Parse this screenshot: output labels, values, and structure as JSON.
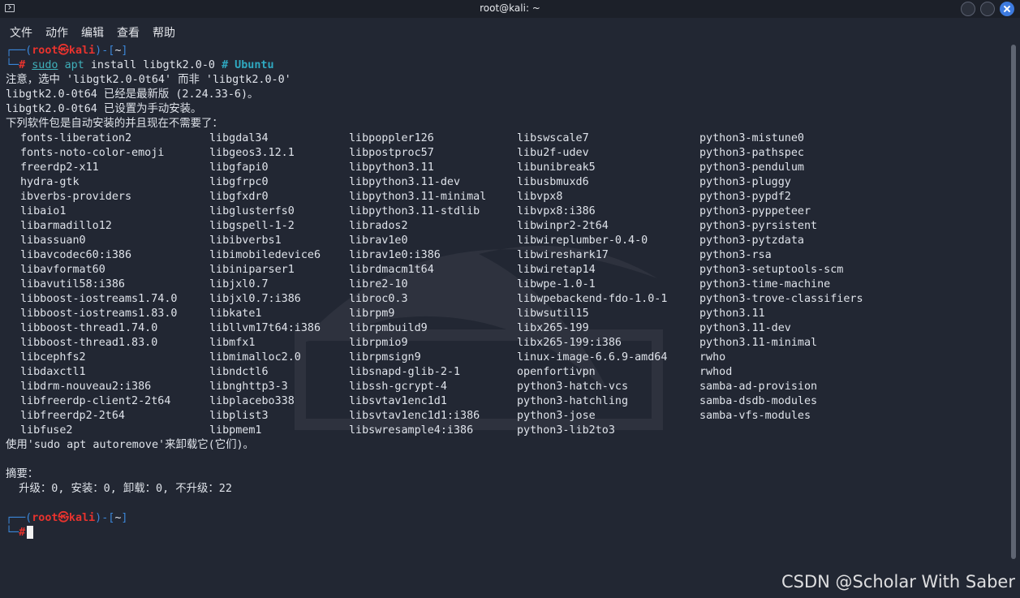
{
  "window": {
    "title": "root@kali: ~"
  },
  "menu": [
    "文件",
    "动作",
    "编辑",
    "查看",
    "帮助"
  ],
  "prompt": {
    "user": "root",
    "at_symbol": "㉿",
    "host": "kali",
    "cwd": "~",
    "hash": "#"
  },
  "command": {
    "sudo": "sudo",
    "apt": "apt",
    "args": "install libgtk2.0-0",
    "comment": "# Ubuntu"
  },
  "output_lines": [
    "注意，选中 'libgtk2.0-0t64' 而非 'libgtk2.0-0'",
    "libgtk2.0-0t64 已经是最新版 (2.24.33-6)。",
    "libgtk2.0-0t64 已设置为手动安装。",
    "下列软件包是自动安装的并且现在不需要了："
  ],
  "package_columns": [
    [
      "fonts-liberation2",
      "fonts-noto-color-emoji",
      "freerdp2-x11",
      "hydra-gtk",
      "ibverbs-providers",
      "libaio1",
      "libarmadillo12",
      "libassuan0",
      "libavcodec60:i386",
      "libavformat60",
      "libavutil58:i386",
      "libboost-iostreams1.74.0",
      "libboost-iostreams1.83.0",
      "libboost-thread1.74.0",
      "libboost-thread1.83.0",
      "libcephfs2",
      "libdaxctl1",
      "libdrm-nouveau2:i386",
      "libfreerdp-client2-2t64",
      "libfreerdp2-2t64",
      "libfuse2"
    ],
    [
      "libgdal34",
      "libgeos3.12.1",
      "libgfapi0",
      "libgfrpc0",
      "libgfxdr0",
      "libglusterfs0",
      "libgspell-1-2",
      "libibverbs1",
      "libimobiledevice6",
      "libiniparser1",
      "libjxl0.7",
      "libjxl0.7:i386",
      "libkate1",
      "libllvm17t64:i386",
      "libmfx1",
      "libmimalloc2.0",
      "libndctl6",
      "libnghttp3-3",
      "libplacebo338",
      "libplist3",
      "libpmem1"
    ],
    [
      "libpoppler126",
      "libpostproc57",
      "libpython3.11",
      "libpython3.11-dev",
      "libpython3.11-minimal",
      "libpython3.11-stdlib",
      "librados2",
      "librav1e0",
      "librav1e0:i386",
      "librdmacm1t64",
      "libre2-10",
      "libroc0.3",
      "librpm9",
      "librpmbuild9",
      "librpmio9",
      "librpmsign9",
      "libsnapd-glib-2-1",
      "libssh-gcrypt-4",
      "libsvtav1enc1d1",
      "libsvtav1enc1d1:i386",
      "libswresample4:i386"
    ],
    [
      "libswscale7",
      "libu2f-udev",
      "libunibreak5",
      "libusbmuxd6",
      "libvpx8",
      "libvpx8:i386",
      "libwinpr2-2t64",
      "libwireplumber-0.4-0",
      "libwireshark17",
      "libwiretap14",
      "libwpe-1.0-1",
      "libwpebackend-fdo-1.0-1",
      "libwsutil15",
      "libx265-199",
      "libx265-199:i386",
      "linux-image-6.6.9-amd64",
      "openfortivpn",
      "python3-hatch-vcs",
      "python3-hatchling",
      "python3-jose",
      "python3-lib2to3"
    ],
    [
      "python3-mistune0",
      "python3-pathspec",
      "python3-pendulum",
      "python3-pluggy",
      "python3-pypdf2",
      "python3-pyppeteer",
      "python3-pyrsistent",
      "python3-pytzdata",
      "python3-rsa",
      "python3-setuptools-scm",
      "python3-time-machine",
      "python3-trove-classifiers",
      "python3.11",
      "python3.11-dev",
      "python3.11-minimal",
      "rwho",
      "rwhod",
      "samba-ad-provision",
      "samba-dsdb-modules",
      "samba-vfs-modules"
    ]
  ],
  "autoremove_line": "使用'sudo apt autoremove'来卸载它(它们)。",
  "summary_title": "摘要：",
  "summary_line": "  升级：0, 安装：0, 卸载：0, 不升级：22",
  "watermark": "CSDN @Scholar With Saber"
}
